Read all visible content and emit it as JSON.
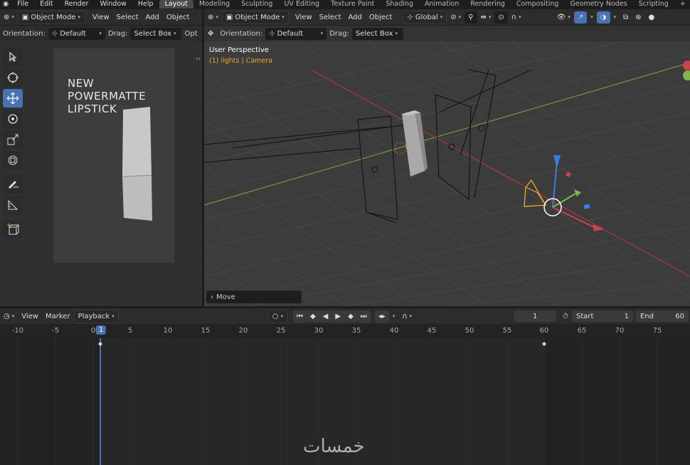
{
  "menu": [
    "File",
    "Edit",
    "Render",
    "Window",
    "Help"
  ],
  "workspaces": [
    "Layout",
    "Modeling",
    "Sculpting",
    "UV Editing",
    "Texture Paint",
    "Shading",
    "Animation",
    "Rendering",
    "Compositing",
    "Geometry Nodes",
    "Scripting"
  ],
  "active_workspace": "Layout",
  "left_editor": {
    "mode": "Object Mode",
    "menus": [
      "View",
      "Select",
      "Add",
      "Object"
    ],
    "orientation_label": "Orientation:",
    "orientation_value": "Default",
    "drag_label": "Drag:",
    "drag_value": "Select Box",
    "options_label": "Opt",
    "reference_text": "NEW\nPOWERMATTE\nLIPSTICK"
  },
  "viewport": {
    "mode": "Object Mode",
    "menus": [
      "View",
      "Select",
      "Add",
      "Object"
    ],
    "transform_space": "Global",
    "orientation_label": "Orientation:",
    "orientation_value": "Default",
    "drag_label": "Drag:",
    "drag_value": "Select Box",
    "perspective": "User Perspective",
    "collection": "(1) lights | Camera",
    "last_op": "Move"
  },
  "timeline": {
    "menus": [
      "View",
      "Marker"
    ],
    "playback": "Playback",
    "current_frame": "1",
    "start_label": "Start",
    "start_value": "1",
    "end_label": "End",
    "end_value": "60",
    "ruler": [
      "-10",
      "-5",
      "0",
      "1",
      "5",
      "10",
      "15",
      "20",
      "25",
      "30",
      "35",
      "40",
      "45",
      "50",
      "55",
      "60",
      "65",
      "70",
      "75"
    ],
    "playhead": "1"
  },
  "watermark": "خمسات",
  "colors": {
    "accent": "#4772b3",
    "orange": "#f0a830",
    "x_axis": "#c8434b",
    "y_axis": "#7fb74a",
    "z_axis": "#3a7ee0"
  }
}
